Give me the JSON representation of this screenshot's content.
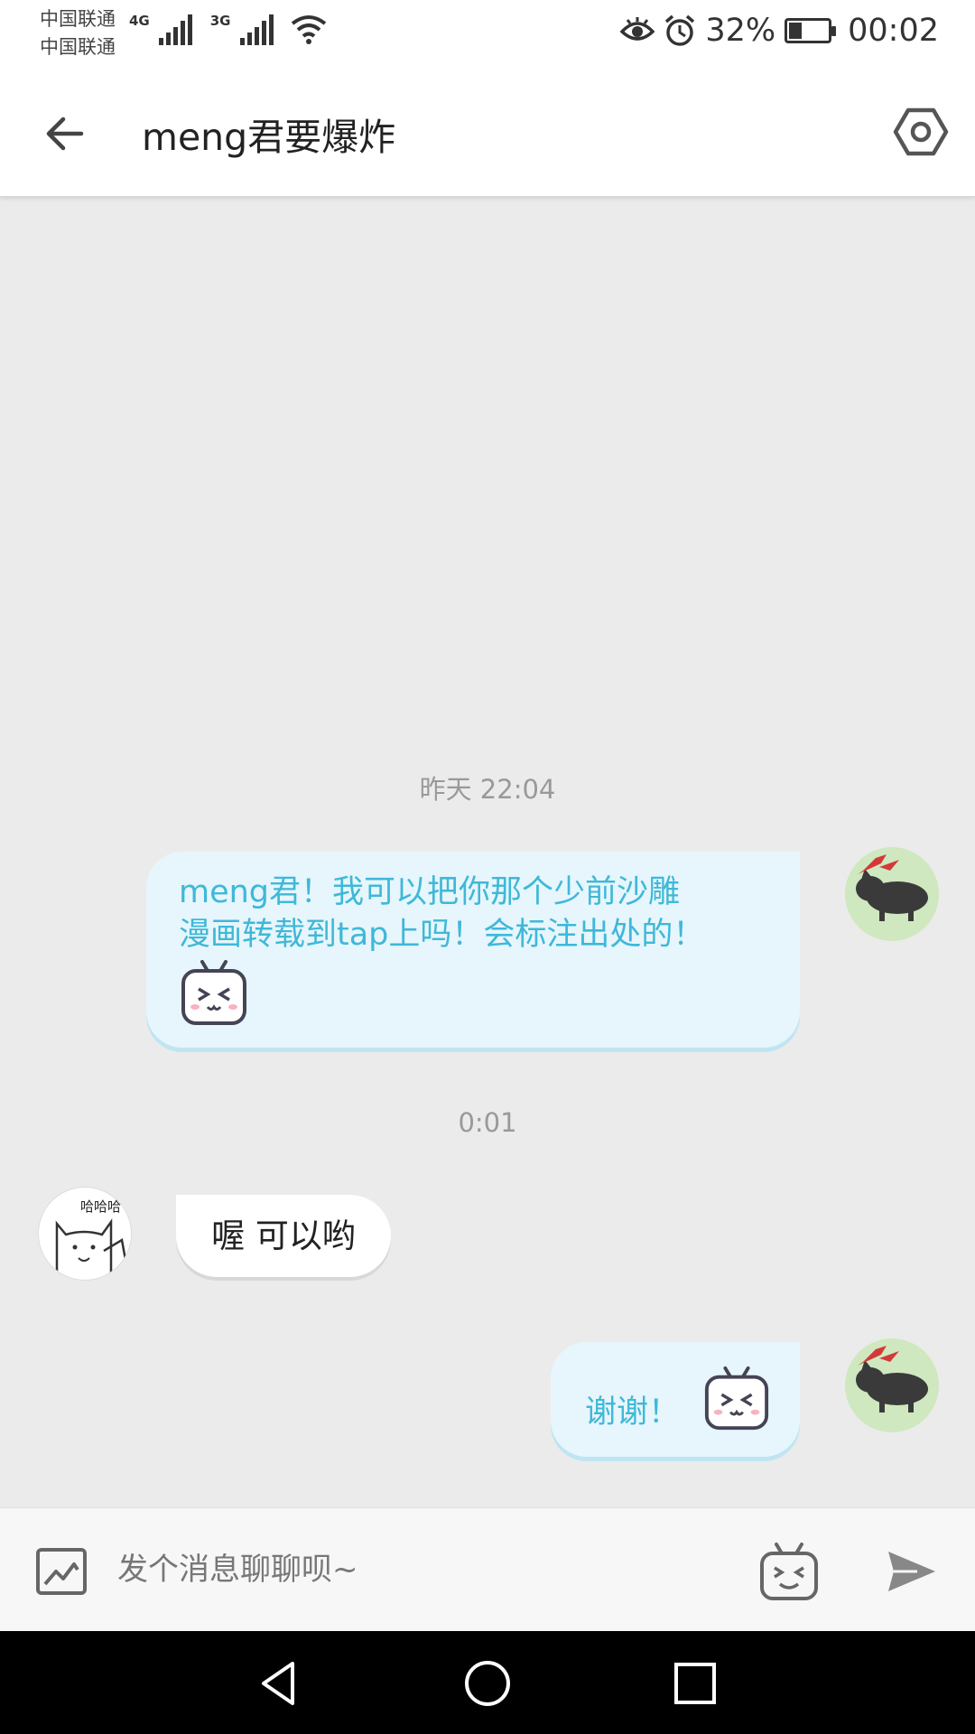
{
  "status_bar": {
    "carrier_1": "中国联通",
    "carrier_2": "中国联通",
    "network_1": "4G",
    "network_2": "3G",
    "battery_percent": "32%",
    "battery_level": 0.32,
    "time": "00:02",
    "icons": [
      "signal-icon",
      "wifi-icon",
      "eye-icon",
      "alarm-icon",
      "battery-icon"
    ]
  },
  "header": {
    "title": "meng君要爆炸",
    "back_icon": "arrow-left-icon",
    "settings_icon": "hexagon-settings-icon"
  },
  "chat": {
    "messages": [
      {
        "timestamp": "昨天 22:04"
      },
      {
        "direction": "outgoing",
        "line1": "meng君！我可以把你那个少前沙雕",
        "line2": "漫画转载到tap上吗！会标注出处的！",
        "emoji": "tv-face-emoji"
      },
      {
        "timestamp": "0:01"
      },
      {
        "direction": "incoming",
        "text": "喔 可以哟",
        "avatar_caption": "哈哈哈"
      },
      {
        "direction": "outgoing",
        "text": "谢谢！",
        "emoji": "tv-face-emoji"
      }
    ]
  },
  "input_bar": {
    "placeholder": "发个消息聊聊呗~",
    "image_icon": "image-icon",
    "emoji_icon": "tv-emoji-icon",
    "send_icon": "send-icon"
  },
  "colors": {
    "accent": "#3fb8d8",
    "bubble_out": "#e6f6fc",
    "background": "#ebebeb"
  }
}
